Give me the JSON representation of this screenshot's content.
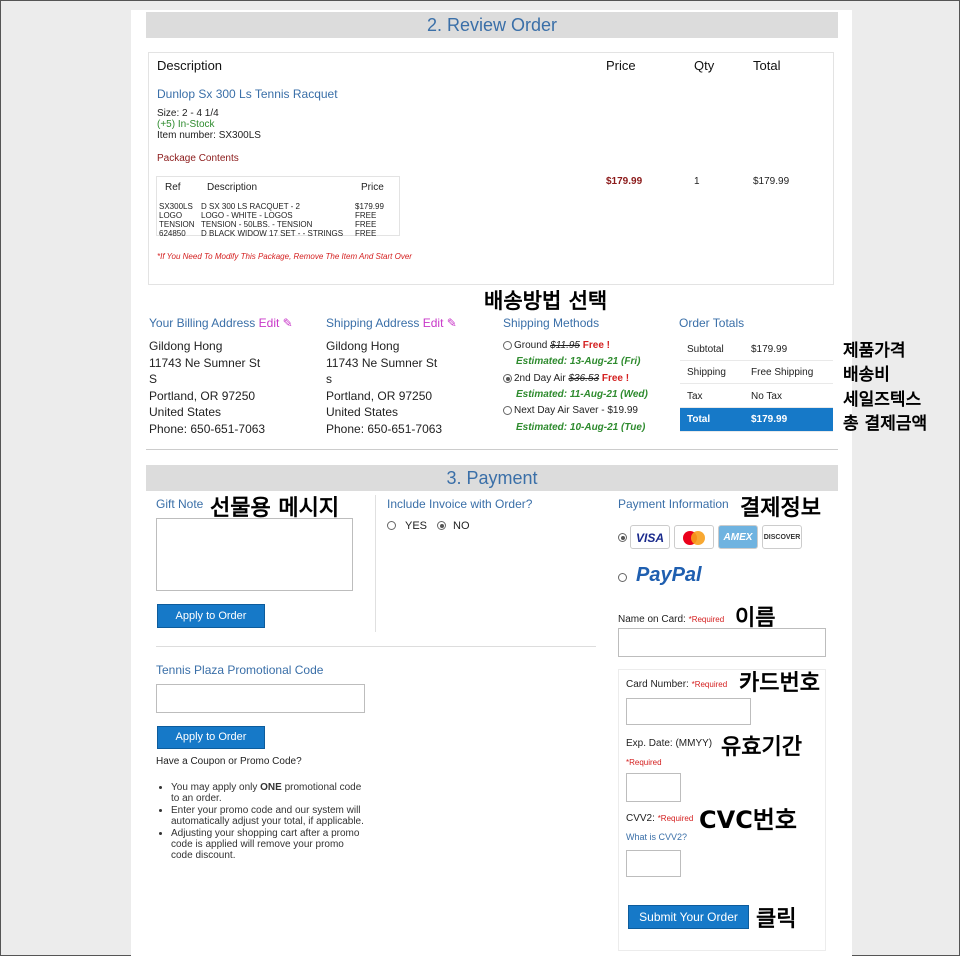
{
  "review": {
    "heading": "2. Review Order",
    "headers": {
      "description": "Description",
      "price": "Price",
      "qty": "Qty",
      "total": "Total"
    },
    "product": {
      "name": "Dunlop Sx 300 Ls Tennis Racquet",
      "size": "Size: 2 - 4 1/4",
      "stock": "(+5) In-Stock",
      "item_number": "Item number: SX300LS",
      "package_title": "Package Contents",
      "price": "$179.99",
      "qty": "1",
      "total": "$179.99"
    },
    "package": {
      "headers": {
        "ref": "Ref",
        "desc": "Description",
        "price": "Price"
      },
      "rows": [
        {
          "ref": "SX300LS",
          "desc": "D SX 300 LS RACQUET - 2",
          "price": "$179.99"
        },
        {
          "ref": "LOGO",
          "desc": "LOGO - WHITE - LOGOS",
          "price": "FREE"
        },
        {
          "ref": "TENSION",
          "desc": "TENSION - 50LBS. - TENSION",
          "price": "FREE"
        },
        {
          "ref": "624850",
          "desc": "D BLACK WIDOW 17 SET - - STRINGS",
          "price": "FREE"
        }
      ]
    },
    "modify_note": "*If You Need To Modify This Package, Remove The Item And Start Over"
  },
  "billing": {
    "title": "Your Billing Address",
    "edit": "Edit",
    "lines": [
      "Gildong Hong",
      "11743 Ne Sumner St",
      "S",
      "Portland, OR 97250",
      "United States",
      "Phone: 650-651-7063"
    ]
  },
  "shipping_addr": {
    "title": "Shipping Address",
    "edit": "Edit",
    "lines": [
      "Gildong Hong",
      "11743 Ne Sumner St",
      "s",
      "Portland, OR 97250",
      "United States",
      "Phone: 650-651-7063"
    ]
  },
  "shipping_methods": {
    "title": "Shipping Methods",
    "options": [
      {
        "label": "Ground",
        "old": "$11.95",
        "free": "Free !",
        "est": "Estimated: 13-Aug-21 (Fri)",
        "selected": false
      },
      {
        "label": "2nd Day Air",
        "old": "$36.53",
        "free": "Free !",
        "est": "Estimated: 11-Aug-21 (Wed)",
        "selected": true
      },
      {
        "label": "Next Day Air Saver - $19.99",
        "est": "Estimated: 10-Aug-21 (Tue)",
        "selected": false
      }
    ]
  },
  "order_totals": {
    "title": "Order Totals",
    "rows": [
      {
        "label": "Subtotal",
        "value": "$179.99"
      },
      {
        "label": "Shipping",
        "value": "Free Shipping"
      },
      {
        "label": "Tax",
        "value": "No Tax"
      },
      {
        "label": "Total",
        "value": "$179.99"
      }
    ]
  },
  "payment": {
    "heading": "3. Payment",
    "gift_note_label": "Gift Note",
    "apply_label": "Apply to Order",
    "invoice_label": "Include Invoice with Order?",
    "invoice_yes": "YES",
    "invoice_no": "NO",
    "promo_label": "Tennis Plaza Promotional Code",
    "promo_apply_label": "Apply to Order",
    "coupon_question": "Have a Coupon or Promo Code?",
    "tips": [
      "You may apply only ONE promotional code to an order.",
      "Enter your promo code and our system will automatically adjust your total, if applicable.",
      "Adjusting your shopping cart after a promo code is applied will remove your promo code discount."
    ],
    "tip_bold": "ONE",
    "info_title": "Payment Information",
    "cards": [
      "VISA",
      "AMEX",
      "DISCOVER"
    ],
    "paypal": "PayPal",
    "name_label": "Name on Card:",
    "card_label": "Card Number:",
    "exp_label": "Exp. Date: (MMYY)",
    "cvv_label": "CVV2:",
    "required": "*Required",
    "what_cvv": "What is CVV2?",
    "submit": "Submit Your Order"
  },
  "annotations": {
    "shipping": "배송방법 선택",
    "product_price": "제품가격",
    "shipping_fee": "배송비",
    "sales_tax": "세일즈텍스",
    "total": "총 결제금액",
    "gift": "선물용 메시지",
    "pay_info": "결제정보",
    "name": "이름",
    "card": "카드번호",
    "exp": "유효기간",
    "cvc": "CVC번호",
    "click": "클릭"
  },
  "colors": {
    "accent_blue": "#1679c8",
    "heading_blue": "#3a6fa8",
    "free_red": "#d42020",
    "est_green": "#2e8b2e"
  }
}
